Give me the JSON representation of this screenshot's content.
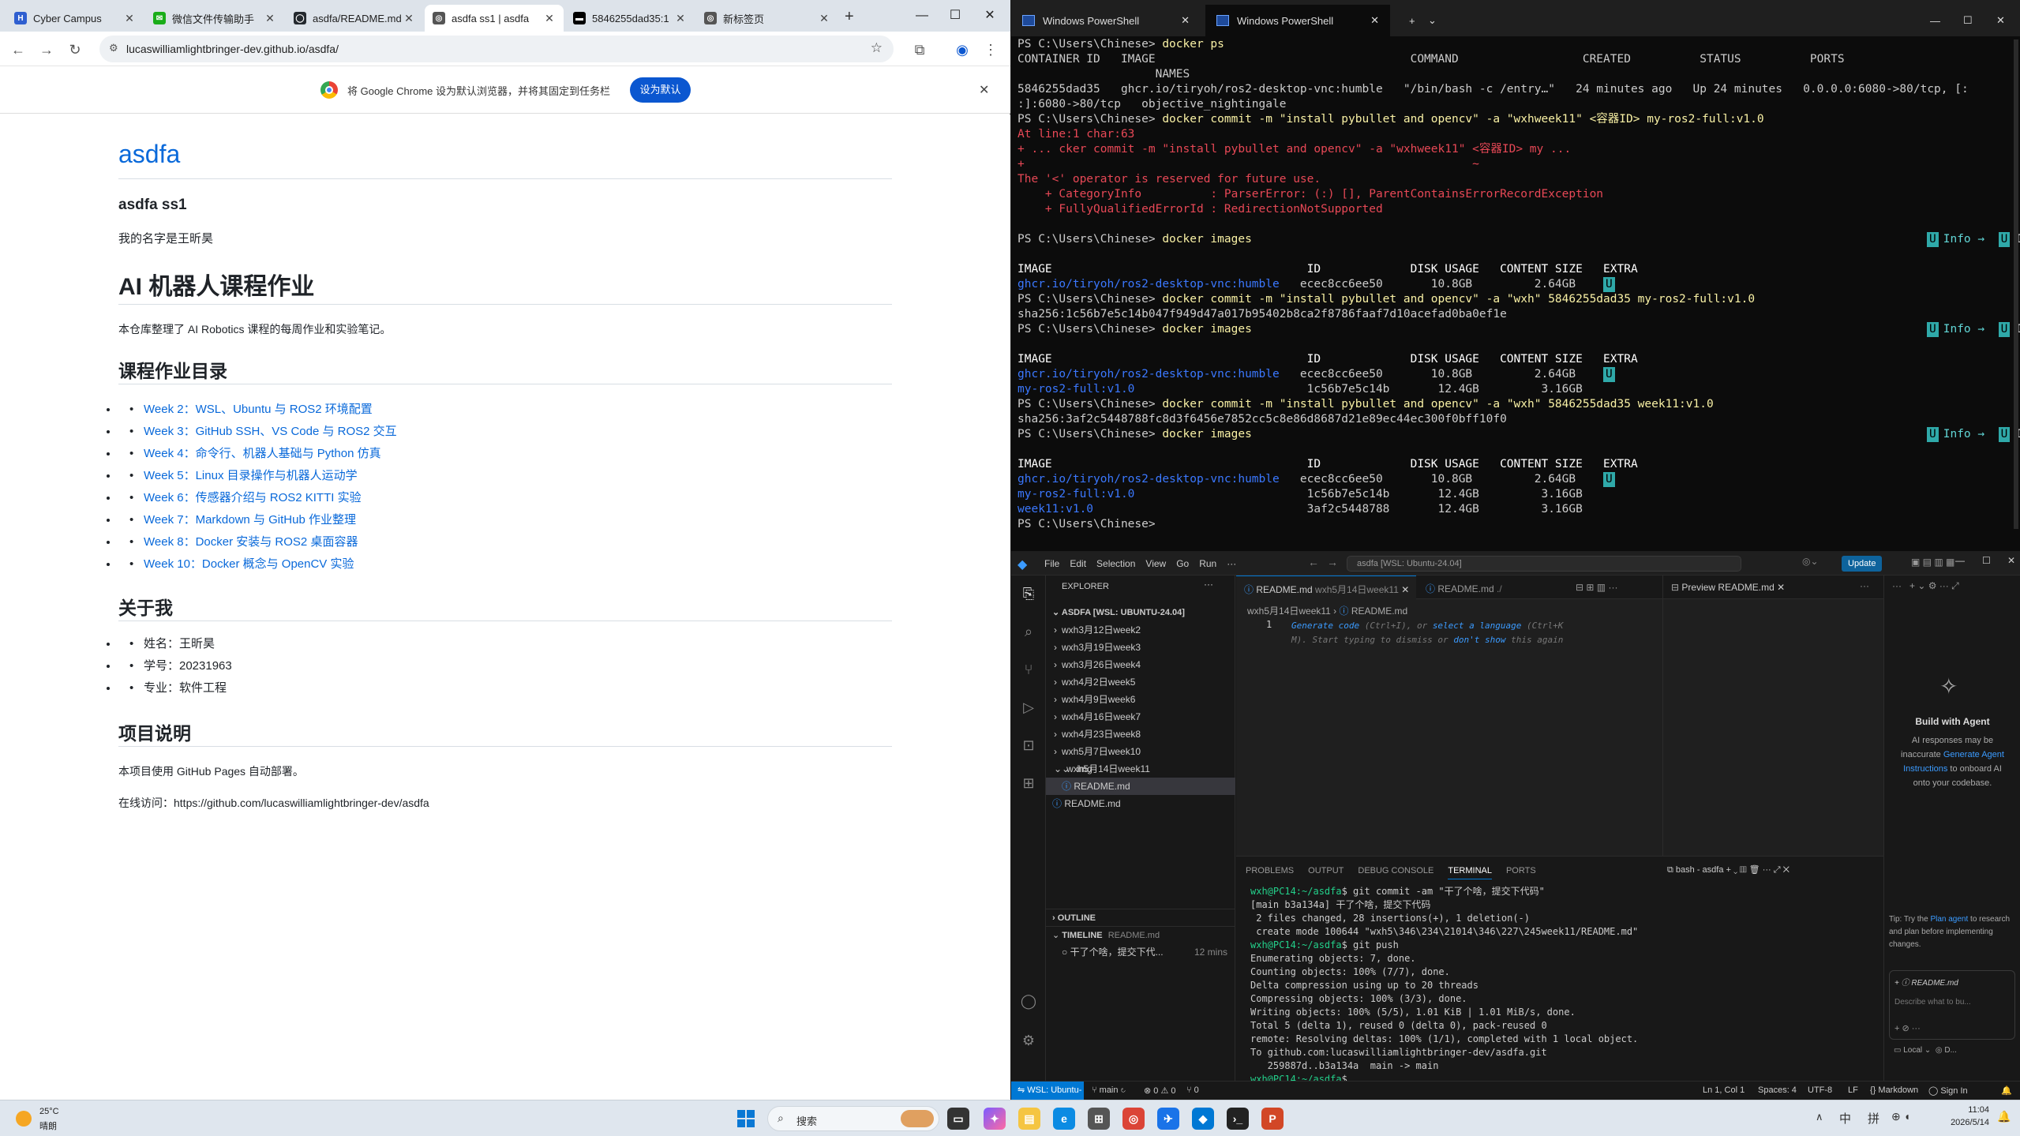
{
  "chrome": {
    "tabs": [
      {
        "title": "Cyber Campus",
        "icon": "cyber-campus-icon",
        "color": "#2f5fd0",
        "glyph": "H"
      },
      {
        "title": "微信文件传输助手",
        "icon": "wechat-icon",
        "color": "#1aad19",
        "glyph": "✉"
      },
      {
        "title": "asdfa/README.md",
        "icon": "github-icon",
        "color": "#24292f",
        "glyph": "◯"
      },
      {
        "title": "asdfa ss1 | asdfa",
        "icon": "globe-icon",
        "color": "#555555",
        "glyph": "◎"
      },
      {
        "title": "5846255dad35:1",
        "icon": "vnc-icon",
        "color": "#000000",
        "glyph": "▬"
      },
      {
        "title": "新标签页",
        "icon": "globe-icon",
        "color": "#555555",
        "glyph": "◎"
      }
    ],
    "url": "lucaswilliamlightbringer-dev.github.io/asdfa/",
    "infobar_message": "将 Google Chrome 设为默认浏览器，并将其固定到任务栏",
    "infobar_button": "设为默认"
  },
  "page": {
    "site_title": "asdfa",
    "subtitle": "asdfa ss1",
    "intro": "我的名字是王昕昊",
    "h1": "AI 机器人课程作业",
    "description": "本仓库整理了 AI Robotics 课程的每周作业和实验笔记。",
    "toc_heading": "课程作业目录",
    "toc": [
      "Week 2：WSL、Ubuntu 与 ROS2 环境配置",
      "Week 3：GitHub SSH、VS Code 与 ROS2 交互",
      "Week 4：命令行、机器人基础与 Python 仿真",
      "Week 5：Linux 目录操作与机器人运动学",
      "Week 6：传感器介绍与 ROS2 KITTI 实验",
      "Week 7：Markdown 与 GitHub 作业整理",
      "Week 8：Docker 安装与 ROS2 桌面容器",
      "Week 10：Docker 概念与 OpenCV 实验"
    ],
    "about_heading": "关于我",
    "about": [
      "姓名：王昕昊",
      "学号：20231963",
      "专业：软件工程"
    ],
    "project_heading": "项目说明",
    "project_text": "本项目使用 GitHub Pages 自动部署。",
    "online_text": "在线访问：https://github.com/lucaswilliamlightbringer-dev/asdfa"
  },
  "terminal": {
    "tabs": [
      "Windows PowerShell",
      "Windows PowerShell"
    ],
    "info_label": "Info →",
    "inuse_label": "In Use",
    "u_badge": "U",
    "lines": [
      {
        "text": "PS C:\\Users\\Chinese> ",
        "cmd": "docker ps",
        "cls": ""
      },
      {
        "text": "CONTAINER ID   IMAGE                                     COMMAND                  CREATED          STATUS          PORTS",
        "cls": ""
      },
      {
        "text": "                    NAMES",
        "cls": ""
      },
      {
        "text": "5846255dad35   ghcr.io/tiryoh/ros2-desktop-vnc:humble   \"/bin/bash -c /entry…\"   24 minutes ago   Up 24 minutes   0.0.0.0:6080->80/tcp, [:",
        "cls": ""
      },
      {
        "text": ":]:6080->80/tcp   objective_nightingale",
        "cls": ""
      },
      {
        "text": "PS C:\\Users\\Chinese> ",
        "cmd": "docker commit -m \"install pybullet and opencv\" -a \"wxhweek11\" <容器ID> my-ros2-full:v1.0",
        "cls": ""
      },
      {
        "text": "At line:1 char:63",
        "cls": "rd"
      },
      {
        "text": "+ ... cker commit -m \"install pybullet and opencv\" -a \"wxhweek11\" <容器ID> my ...",
        "cls": "rd"
      },
      {
        "text": "+                                                                 ~",
        "cls": "rd"
      },
      {
        "text": "The '<' operator is reserved for future use.",
        "cls": "rd"
      },
      {
        "text": "    + CategoryInfo          : ParserError: (:) [], ParentContainsErrorRecordException",
        "cls": "rd"
      },
      {
        "text": "    + FullyQualifiedErrorId : RedirectionNotSupported",
        "cls": "rd"
      },
      {
        "text": "",
        "cls": ""
      },
      {
        "text": "PS C:\\Users\\Chinese> ",
        "cmd": "docker images",
        "cls": "",
        "info": true
      },
      {
        "text": "",
        "cls": ""
      },
      {
        "text": "IMAGE                                     ID             DISK USAGE   CONTENT SIZE   EXTRA",
        "cls": "w"
      },
      {
        "text": "ghcr.io/tiryoh/ros2-desktop-vnc:humble",
        "rest": "   ecec8cc6ee50       10.8GB         2.64GB    ",
        "cls": "bl",
        "badge": true
      },
      {
        "text": "PS C:\\Users\\Chinese> ",
        "cmd": "docker commit -m \"install pybullet and opencv\" -a \"wxh\" 5846255dad35 my-ros2-full:v1.0",
        "cls": ""
      },
      {
        "text": "sha256:1c56b7e5c14b047f949d47a017b95402b8ca2f8786faaf7d10acefad0ba0ef1e",
        "cls": ""
      },
      {
        "text": "PS C:\\Users\\Chinese> ",
        "cmd": "docker images",
        "cls": "",
        "info": true
      },
      {
        "text": "",
        "cls": ""
      },
      {
        "text": "IMAGE                                     ID             DISK USAGE   CONTENT SIZE   EXTRA",
        "cls": "w"
      },
      {
        "text": "ghcr.io/tiryoh/ros2-desktop-vnc:humble",
        "rest": "   ecec8cc6ee50       10.8GB         2.64GB    ",
        "cls": "bl",
        "badge": true
      },
      {
        "text": "my-ros2-full:v1.0",
        "rest": "                         1c56b7e5c14b       12.4GB         3.16GB",
        "cls": "bl"
      },
      {
        "text": "PS C:\\Users\\Chinese> ",
        "cmd": "docker commit -m \"install pybullet and opencv\" -a \"wxh\" 5846255dad35 week11:v1.0",
        "cls": ""
      },
      {
        "text": "sha256:3af2c5448788fc8d3f6456e7852cc5c8e86d8687d21e89ec44ec300f0bff10f0",
        "cls": ""
      },
      {
        "text": "PS C:\\Users\\Chinese> ",
        "cmd": "docker images",
        "cls": "",
        "info": true
      },
      {
        "text": "",
        "cls": ""
      },
      {
        "text": "IMAGE                                     ID             DISK USAGE   CONTENT SIZE   EXTRA",
        "cls": "w"
      },
      {
        "text": "ghcr.io/tiryoh/ros2-desktop-vnc:humble",
        "rest": "   ecec8cc6ee50       10.8GB         2.64GB    ",
        "cls": "bl",
        "badge": true
      },
      {
        "text": "my-ros2-full:v1.0",
        "rest": "                         1c56b7e5c14b       12.4GB         3.16GB",
        "cls": "bl"
      },
      {
        "text": "week11:v1.0",
        "rest": "                               3af2c5448788       12.4GB         3.16GB",
        "cls": "bl"
      },
      {
        "text": "PS C:\\Users\\Chinese>",
        "cls": ""
      }
    ]
  },
  "vscode": {
    "menu": [
      "File",
      "Edit",
      "Selection",
      "View",
      "Go",
      "Run",
      "···"
    ],
    "search": "asdfa [WSL: Ubuntu-24.04]",
    "update": "Update",
    "explorer_title": "EXPLORER",
    "workspace": "ASDFA [WSL: UBUNTU-24.04]",
    "folders": [
      "wxh3月12日week2",
      "wxh3月19日week3",
      "wxh3月26日week4",
      "wxh4月2日week5",
      "wxh4月9日week6",
      "wxh4月16日week7",
      "wxh4月23日week8",
      "wxh5月7日week10",
      "wxh5月14日week11"
    ],
    "subfolder": "img",
    "active_file": "README.md",
    "root_file": "README.md",
    "outline": "OUTLINE",
    "timeline": "TIMELINE",
    "timeline_file": "README.md",
    "timeline_entry": "干了个啥，提交下代...",
    "timeline_time": "12 mins",
    "editor_tabs": [
      {
        "name": "README.md",
        "path": "wxh5月14日week11"
      },
      {
        "name": "README.md",
        "path": "./"
      },
      {
        "name": "Preview README.md",
        "path": ""
      }
    ],
    "breadcrumb": [
      "wxh5月14日week11",
      "README.md"
    ],
    "line_no": "1",
    "hint1_a": "Generate code",
    "hint1_b": " (Ctrl+I), or ",
    "hint1_c": "select a language",
    "hint1_d": " (Ctrl+K",
    "hint2_a": "M). Start typing to dismiss or ",
    "hint2_b": "don't show",
    "hint2_c": " this again",
    "panel_tabs": [
      "PROBLEMS",
      "OUTPUT",
      "DEBUG CONSOLE",
      "TERMINAL",
      "PORTS"
    ],
    "panel_shell": "bash - asdfa",
    "terminal_prompt": "wxh@PC14:~/asdfa",
    "terminal": [
      {
        "p": true,
        "t": "$ git commit -am \"干了个啥，提交下代码\""
      },
      {
        "t": "[main b3a134a] 干了个啥，提交下代码"
      },
      {
        "t": " 2 files changed, 28 insertions(+), 1 deletion(-)"
      },
      {
        "t": " create mode 100644 \"wxh5\\346\\234\\21014\\346\\227\\245week11/README.md\""
      },
      {
        "p": true,
        "t": "$ git push"
      },
      {
        "t": "Enumerating objects: 7, done."
      },
      {
        "t": "Counting objects: 100% (7/7), done."
      },
      {
        "t": "Delta compression using up to 20 threads"
      },
      {
        "t": "Compressing objects: 100% (3/3), done."
      },
      {
        "t": "Writing objects: 100% (5/5), 1.01 KiB | 1.01 MiB/s, done."
      },
      {
        "t": "Total 5 (delta 1), reused 0 (delta 0), pack-reused 0"
      },
      {
        "t": "remote: Resolving deltas: 100% (1/1), completed with 1 local object."
      },
      {
        "t": "To github.com:lucaswilliamlightbringer-dev/asdfa.git"
      },
      {
        "t": "   259887d..b3a134a  main -> main"
      },
      {
        "p": true,
        "t": "$ "
      }
    ],
    "chat": {
      "title": "Build with Agent",
      "body1": "AI responses may be inaccurate",
      "link": "Generate Agent Instructions",
      "body2": " to onboard AI onto your codebase.",
      "tip_label": "Tip: ",
      "tip1": "Try the ",
      "tip_link": "Plan agent",
      "tip2": " to research and plan before implementing changes.",
      "attach": "README.md",
      "placeholder": "Describe what to bu...",
      "local": "Local",
      "d": "D..."
    },
    "status": {
      "remote": "WSL: Ubuntu-24.04",
      "branch": "main",
      "errors": "⊗ 0 ⚠ 0",
      "ports": "⑂ 0",
      "position": "Ln 1, Col 1",
      "spaces": "Spaces: 4",
      "encoding": "UTF-8",
      "eol": "LF",
      "lang": "Markdown",
      "signin": "Sign In"
    }
  },
  "taskbar": {
    "temp": "25°C",
    "weather": "晴朗",
    "search": "搜索",
    "ime1": "中",
    "ime2": "拼",
    "time": "11:04",
    "date": "2026/5/14"
  }
}
